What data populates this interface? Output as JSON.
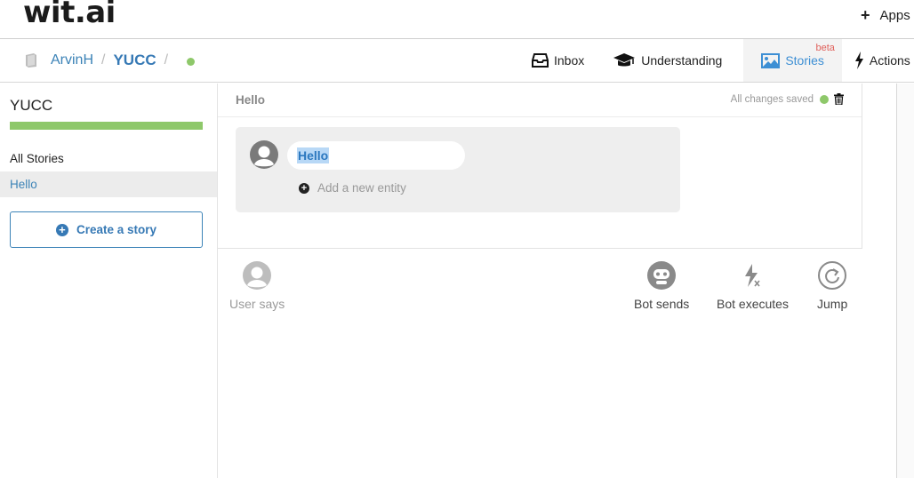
{
  "header": {
    "logo": "wit.ai",
    "apps_label": "Apps"
  },
  "breadcrumb": {
    "user": "ArvinH",
    "separator": "/",
    "app": "YUCC",
    "separator2": "/"
  },
  "tabs": [
    {
      "label": "Inbox",
      "icon": "inbox-icon"
    },
    {
      "label": "Understanding",
      "icon": "graduation-cap-icon"
    },
    {
      "label": "Stories",
      "icon": "image-icon",
      "badge": "beta",
      "active": true
    },
    {
      "label": "Actions",
      "icon": "bolt-icon"
    }
  ],
  "sidebar": {
    "title": "YUCC",
    "section": "All Stories",
    "items": [
      {
        "label": "Hello",
        "selected": true
      }
    ],
    "create_button": "Create a story"
  },
  "story": {
    "name": "Hello",
    "status": "All changes saved",
    "user_message": "Hello",
    "add_entity": "Add a new entity"
  },
  "actions": {
    "user_says": "User says",
    "bot_sends": "Bot sends",
    "bot_executes": "Bot executes",
    "jump": "Jump"
  },
  "colors": {
    "accent_blue": "#3679b5",
    "status_green": "#8ec86a",
    "beta_red": "#e0615b"
  }
}
